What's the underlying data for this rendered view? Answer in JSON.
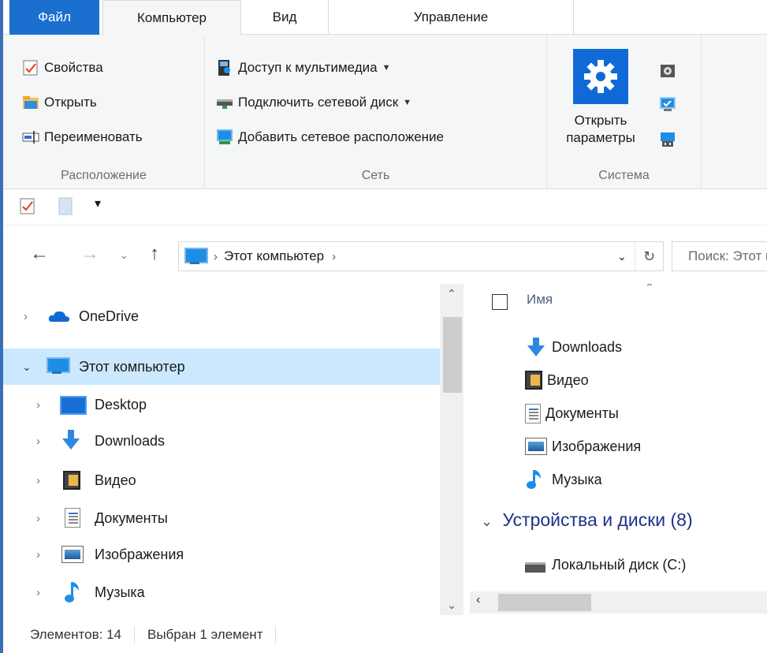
{
  "ribbon_tabs": {
    "file": "Файл",
    "computer": "Компьютер",
    "view": "Вид",
    "manage": "Управление"
  },
  "ribbon": {
    "location_group": {
      "label": "Расположение",
      "properties": "Свойства",
      "open": "Открыть",
      "rename": "Переименовать"
    },
    "network_group": {
      "label": "Сеть",
      "media_access": "Доступ к мультимедиа",
      "map_drive": "Подключить сетевой диск",
      "add_location": "Добавить сетевое расположение"
    },
    "system_group": {
      "label": "Система",
      "open_settings_line1": "Открыть",
      "open_settings_line2": "параметры"
    }
  },
  "qat": {
    "customize_glyph": "▾"
  },
  "address": {
    "crumb": "Этот компьютер",
    "search_placeholder": "Поиск: Этот компьютер"
  },
  "nav_pane": {
    "onedrive": "OneDrive",
    "this_pc": "Этот компьютер",
    "items": [
      "Desktop",
      "Downloads",
      "Видео",
      "Документы",
      "Изображения",
      "Музыка"
    ]
  },
  "content": {
    "column_name": "Имя",
    "folders": [
      "Downloads",
      "Видео",
      "Документы",
      "Изображения",
      "Музыка"
    ],
    "section_title": "Устройства и диски (8)",
    "drives": [
      "Локальный диск (C:)"
    ]
  },
  "status": {
    "count": "Элементов: 14",
    "selected": "Выбран 1 элемент"
  },
  "colors": {
    "accent": "#1a6fcf",
    "selection": "#cce8ff",
    "section": "#1e3287"
  }
}
